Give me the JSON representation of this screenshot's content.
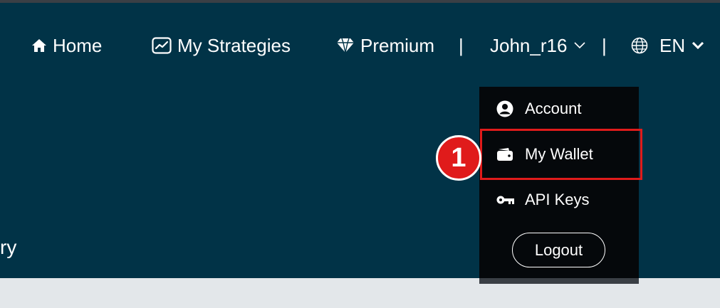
{
  "nav": {
    "home": {
      "label": "Home",
      "icon": "home-icon"
    },
    "strategies": {
      "label": "My Strategies",
      "icon": "chart-line-icon"
    },
    "premium": {
      "label": "Premium",
      "icon": "diamond-icon"
    },
    "separator": "|",
    "user": {
      "label": "John_r16",
      "icon": "chevron-down-icon"
    },
    "language": {
      "label": "EN",
      "icon": "globe-icon"
    }
  },
  "background_text": "ry",
  "dropdown": {
    "items": [
      {
        "label": "Account",
        "icon": "user-circle-icon"
      },
      {
        "label": "My Wallet",
        "icon": "wallet-icon"
      },
      {
        "label": "API Keys",
        "icon": "key-icon"
      }
    ],
    "logout_label": "Logout"
  },
  "annotation": {
    "step": "1",
    "color": "#e01b1b"
  },
  "colors": {
    "header_bg": "#013347",
    "dropdown_bg": "#05080b",
    "page_bg": "#e3e7ea"
  }
}
